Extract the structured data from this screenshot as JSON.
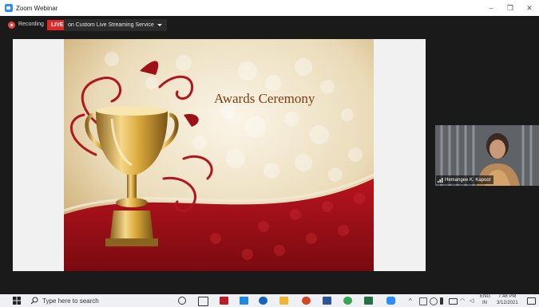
{
  "window": {
    "title": "Zoom Webinar",
    "controls": {
      "minimize": "–",
      "maximize": "❐",
      "close": "✕"
    }
  },
  "status": {
    "recording_label": "Recording",
    "live_badge": "LIVE",
    "streaming_dropdown": "on Custom Live Streaming Service"
  },
  "slide": {
    "title": "Awards Ceremony",
    "colors": {
      "gold": "#d9a83a",
      "red": "#9e1018",
      "cream": "#f3ead6",
      "title_text": "#7a3d12"
    }
  },
  "participant": {
    "name": "Hemangee K. Kapoor"
  },
  "taskbar": {
    "search_placeholder": "Type here to search",
    "language": "ENG",
    "region": "IN",
    "time": "7:48 PM",
    "date": "3/12/2021",
    "apps": [
      "task-view-icon",
      "file-explorer-icon",
      "mcafee-icon",
      "l-app-icon",
      "edge-icon",
      "folder-icon",
      "powerpoint-icon",
      "word-icon",
      "chrome-icon",
      "excel-icon",
      "zoom-icon"
    ]
  }
}
